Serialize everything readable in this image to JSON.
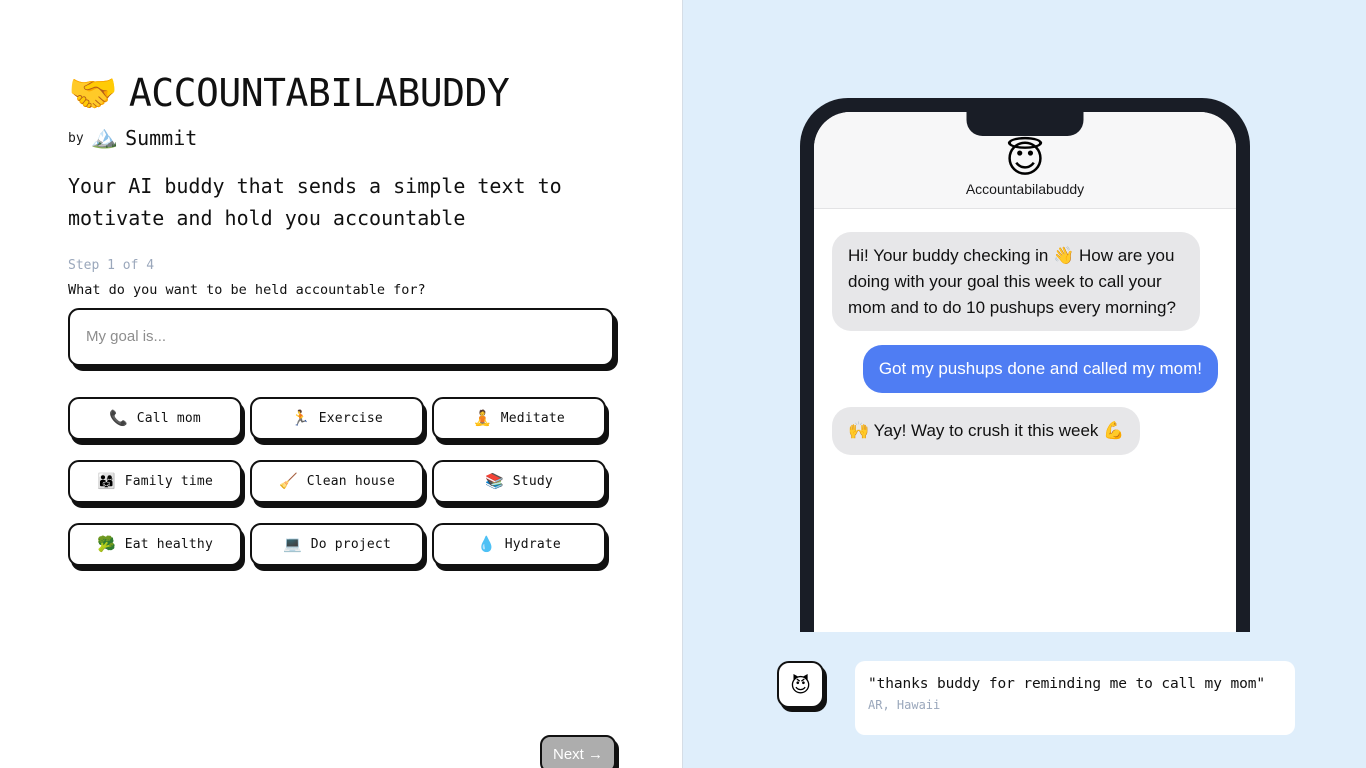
{
  "brand": {
    "emoji": "🤝",
    "emoji_name": "handshake-emoji",
    "title": "ACCOUNTABILABUDDY",
    "by_label": "by",
    "by_emoji": "🏔️",
    "by_name": "Summit",
    "tagline": "Your AI buddy that sends a simple text to motivate and hold you accountable"
  },
  "form": {
    "step_label": "Step 1 of 4",
    "question": "What do you want to be held accountable for?",
    "goal_placeholder": "My goal is...",
    "goal_value": "",
    "next_label": "Next →"
  },
  "chips": [
    {
      "emoji": "📞",
      "label": "Call mom"
    },
    {
      "emoji": "🏃",
      "label": "Exercise"
    },
    {
      "emoji": "🧘",
      "label": "Meditate"
    },
    {
      "emoji": "👨‍👩‍👧",
      "label": "Family time"
    },
    {
      "emoji": "🧹",
      "label": "Clean house"
    },
    {
      "emoji": "📚",
      "label": "Study"
    },
    {
      "emoji": "🥦",
      "label": "Eat healthy"
    },
    {
      "emoji": "💻",
      "label": "Do project"
    },
    {
      "emoji": "💧",
      "label": "Hydrate"
    }
  ],
  "phone": {
    "buddy_avatar": "😇",
    "buddy_name": "Accountabilabuddy",
    "messages": [
      {
        "side": "incoming",
        "text": "Hi! Your buddy checking in 👋 How are you doing with your goal this week to call your mom and to do 10 pushups every morning?"
      },
      {
        "side": "outgoing",
        "text": "Got my pushups done and called my mom!"
      },
      {
        "side": "incoming",
        "text": "🙌 Yay!  Way to crush it this week 💪"
      }
    ]
  },
  "testimonial": {
    "avatar_emoji": "😈",
    "quote": "\"thanks buddy for reminding me to call my mom\"",
    "author": "AR, Hawaii"
  },
  "colors": {
    "right_panel_bg": "#dfeefb",
    "outgoing_bubble": "#4f7df3",
    "incoming_bubble": "#e7e7e9",
    "phone_frame": "#191d26",
    "border": "#111111",
    "muted_text": "#9aa7bb",
    "disabled_button": "#adadad"
  }
}
